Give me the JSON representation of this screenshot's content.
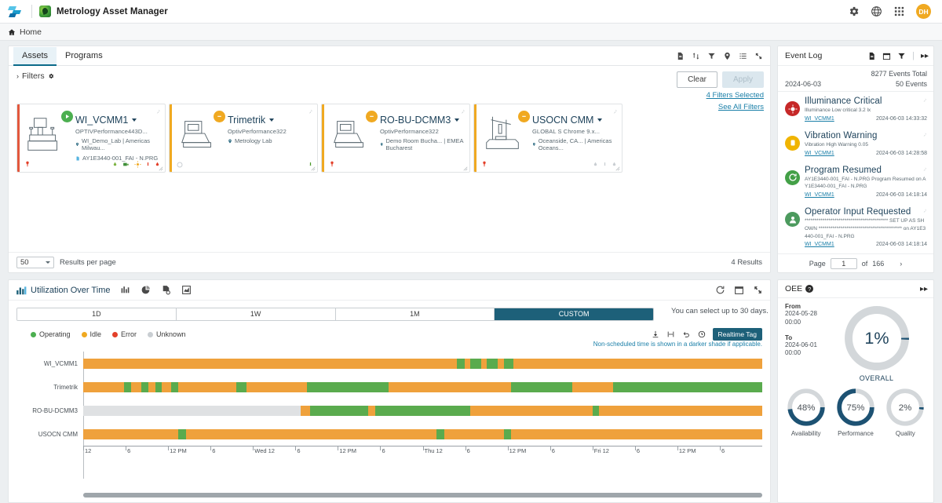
{
  "header": {
    "app_title": "Metrology Asset Manager",
    "icons": [
      "gear-icon",
      "globe-icon",
      "apps-grid-icon"
    ],
    "avatar_initials": "DH"
  },
  "breadcrumb": {
    "home": "Home"
  },
  "assets_panel": {
    "tabs": [
      {
        "label": "Assets",
        "active": true
      },
      {
        "label": "Programs",
        "active": false
      }
    ],
    "toolbar_icons": [
      "export-icon",
      "sort-icon",
      "filter-icon",
      "location-icon",
      "list-view-icon",
      "expand-icon"
    ],
    "filters_label": "Filters",
    "clear_label": "Clear",
    "apply_label": "Apply",
    "filters_selected": "4 Filters Selected",
    "see_all_filters": "See All Filters",
    "results_per_page_value": "50",
    "results_per_page_label": "Results per page",
    "results_count": "4 Results",
    "cards": [
      {
        "name": "WI_VCMM1",
        "model": "OPTIVPerformance443D...",
        "location": "WI_Demo_Lab | Americas Milwau...",
        "program": "AY1E3440-001_FAI - N.PRG",
        "status": "operating",
        "strip_color": "#e3583d",
        "badge": "green"
      },
      {
        "name": "Trimetrik",
        "model": "OptivPerformance322",
        "location": "Metrology Lab",
        "program": "",
        "status": "idle",
        "strip_color": "#f0a921",
        "badge": "amber"
      },
      {
        "name": "RO-BU-DCMM3",
        "model": "OptivPerformance322",
        "location": "Demo Room Bucha... | EMEA Bucharest",
        "program": "",
        "status": "idle",
        "strip_color": "#f0a921",
        "badge": "amber"
      },
      {
        "name": "USOCN CMM",
        "model": "GLOBAL S Chrome 9.x...",
        "location": "Oceanside, CA... | Americas Oceans...",
        "program": "",
        "status": "idle",
        "strip_color": "#f0a921",
        "badge": "amber"
      }
    ]
  },
  "utilization": {
    "title": "Utilization Over Time",
    "header_icons": [
      "bar-chart-icon",
      "pie-chart-icon",
      "report-icon",
      "trend-chart-icon"
    ],
    "header_right_icons": [
      "refresh-icon",
      "calendar-icon",
      "expand-icon"
    ],
    "ranges": [
      {
        "label": "1D",
        "active": false
      },
      {
        "label": "1W",
        "active": false
      },
      {
        "label": "1M",
        "active": false
      },
      {
        "label": "CUSTOM",
        "active": true
      }
    ],
    "range_note": "You can select up to 30 days.",
    "legend": [
      {
        "label": "Operating",
        "color": "#4caf50"
      },
      {
        "label": "Idle",
        "color": "#f0a921"
      },
      {
        "label": "Error",
        "color": "#e3402a"
      },
      {
        "label": "Unknown",
        "color": "#c9ced2"
      }
    ],
    "toolbar_icons": [
      "download-icon",
      "fit-width-icon",
      "undo-icon",
      "clock-icon"
    ],
    "realtime_tag": "Realtime Tag",
    "footnote": "Non-scheduled time is shown in a darker shade if applicable."
  },
  "chart_data": {
    "type": "bar",
    "title": "Utilization Over Time",
    "xlabel": "",
    "ylabel": "",
    "legend_position": "top-left",
    "grid": false,
    "categories": [
      "WI_VCMM1",
      "Trimetrik",
      "RO-BU-DCMM3",
      "USOCN CMM"
    ],
    "x_tick_labels": [
      "12",
      "6",
      "12 PM",
      "6",
      "Wed 12",
      "6",
      "12 PM",
      "6",
      "Thu 12",
      "6",
      "12 PM",
      "6",
      "Fri 12",
      "6",
      "12 PM",
      "6"
    ],
    "state_colors": {
      "Operating": "#4caf50",
      "Idle": "#f0a921",
      "Error": "#e3402a",
      "Unknown": "#dfe1e3"
    },
    "series": [
      {
        "name": "WI_VCMM1",
        "segments": [
          {
            "state": "Idle",
            "start": 0.0,
            "end": 55.0
          },
          {
            "state": "Operating",
            "start": 55.0,
            "end": 56.2
          },
          {
            "state": "Idle",
            "start": 56.2,
            "end": 57.0
          },
          {
            "state": "Operating",
            "start": 57.0,
            "end": 58.6
          },
          {
            "state": "Idle",
            "start": 58.6,
            "end": 59.4
          },
          {
            "state": "Operating",
            "start": 59.4,
            "end": 61.0
          },
          {
            "state": "Idle",
            "start": 61.0,
            "end": 62.0
          },
          {
            "state": "Operating",
            "start": 62.0,
            "end": 63.4
          },
          {
            "state": "Idle",
            "start": 63.4,
            "end": 100.0
          }
        ]
      },
      {
        "name": "Trimetrik",
        "segments": [
          {
            "state": "Idle",
            "start": 0.0,
            "end": 6.0
          },
          {
            "state": "Operating",
            "start": 6.0,
            "end": 7.0
          },
          {
            "state": "Idle",
            "start": 7.0,
            "end": 8.5
          },
          {
            "state": "Operating",
            "start": 8.5,
            "end": 9.6
          },
          {
            "state": "Idle",
            "start": 9.6,
            "end": 10.6
          },
          {
            "state": "Operating",
            "start": 10.6,
            "end": 11.6
          },
          {
            "state": "Idle",
            "start": 11.6,
            "end": 13.0
          },
          {
            "state": "Operating",
            "start": 13.0,
            "end": 14.0
          },
          {
            "state": "Idle",
            "start": 14.0,
            "end": 22.5
          },
          {
            "state": "Operating",
            "start": 22.5,
            "end": 24.0
          },
          {
            "state": "Idle",
            "start": 24.0,
            "end": 33.0
          },
          {
            "state": "Operating",
            "start": 33.0,
            "end": 45.0
          },
          {
            "state": "Idle",
            "start": 45.0,
            "end": 63.0
          },
          {
            "state": "Operating",
            "start": 63.0,
            "end": 72.0
          },
          {
            "state": "Idle",
            "start": 72.0,
            "end": 78.0
          },
          {
            "state": "Operating",
            "start": 78.0,
            "end": 100.0
          }
        ]
      },
      {
        "name": "RO-BU-DCMM3",
        "segments": [
          {
            "state": "Unknown",
            "start": 0.0,
            "end": 32.0
          },
          {
            "state": "Idle",
            "start": 32.0,
            "end": 33.4
          },
          {
            "state": "Operating",
            "start": 33.4,
            "end": 42.0
          },
          {
            "state": "Idle",
            "start": 42.0,
            "end": 43.0
          },
          {
            "state": "Operating",
            "start": 43.0,
            "end": 57.0
          },
          {
            "state": "Idle",
            "start": 57.0,
            "end": 75.0
          },
          {
            "state": "Operating",
            "start": 75.0,
            "end": 76.0
          },
          {
            "state": "Idle",
            "start": 76.0,
            "end": 100.0
          }
        ]
      },
      {
        "name": "USOCN CMM",
        "segments": [
          {
            "state": "Idle",
            "start": 0.0,
            "end": 14.0
          },
          {
            "state": "Operating",
            "start": 14.0,
            "end": 15.2
          },
          {
            "state": "Idle",
            "start": 15.2,
            "end": 52.0
          },
          {
            "state": "Operating",
            "start": 52.0,
            "end": 53.2
          },
          {
            "state": "Idle",
            "start": 53.2,
            "end": 62.0
          },
          {
            "state": "Operating",
            "start": 62.0,
            "end": 63.0
          },
          {
            "state": "Idle",
            "start": 63.0,
            "end": 100.0
          }
        ]
      }
    ]
  },
  "event_log": {
    "title": "Event Log",
    "icons": [
      "export-icon",
      "calendar-icon",
      "filter-icon",
      "collapse-icon"
    ],
    "total": "8277 Events Total",
    "date": "2024-06-03",
    "date_count": "50 Events",
    "events": [
      {
        "title": "Illuminance Critical",
        "desc": "Illuminance Low critical 3.2 lx",
        "asset": "WI_VCMM1",
        "time": "2024-06-03 14:33:32",
        "icon": "alert-critical-icon",
        "color": "#c62828"
      },
      {
        "title": "Vibration Warning",
        "desc": "Vibration High Warning 0.05",
        "asset": "WI_VCMM1",
        "time": "2024-06-03 14:28:58",
        "icon": "alert-warning-icon",
        "color": "#f0b400"
      },
      {
        "title": "Program Resumed",
        "desc": "AY1E3440-001_FAI - N.PRG Program Resumed on AY1E3440-001_FAI - N.PRG",
        "asset": "WI_VCMM1",
        "time": "2024-06-03 14:18:14",
        "icon": "program-resumed-icon",
        "color": "#43a047"
      },
      {
        "title": "Operator Input Requested",
        "desc": "****************************************** SET UP AS SHOWN ****************************************** on AY1E3440-001_FAI - N.PRG",
        "asset": "WI_VCMM1",
        "time": "2024-06-03 14:18:14",
        "icon": "operator-input-icon",
        "color": "#2e7d32"
      }
    ],
    "pager": {
      "page_label": "Page",
      "page_value": "1",
      "of_label": "of",
      "total_pages": "166"
    }
  },
  "oee": {
    "title": "OEE",
    "from_label": "From",
    "from_value": "2024-05-28 00:00",
    "to_label": "To",
    "to_value": "2024-06-01 00:00",
    "overall_value": "1%",
    "overall_label": "OVERALL",
    "gauges": [
      {
        "value": "48%",
        "label": "Availability",
        "percent": 48
      },
      {
        "value": "75%",
        "label": "Performance",
        "percent": 75
      },
      {
        "value": "2%",
        "label": "Quality",
        "percent": 2
      }
    ],
    "accent_color": "#1d5273",
    "track_color": "#d3d7da"
  }
}
